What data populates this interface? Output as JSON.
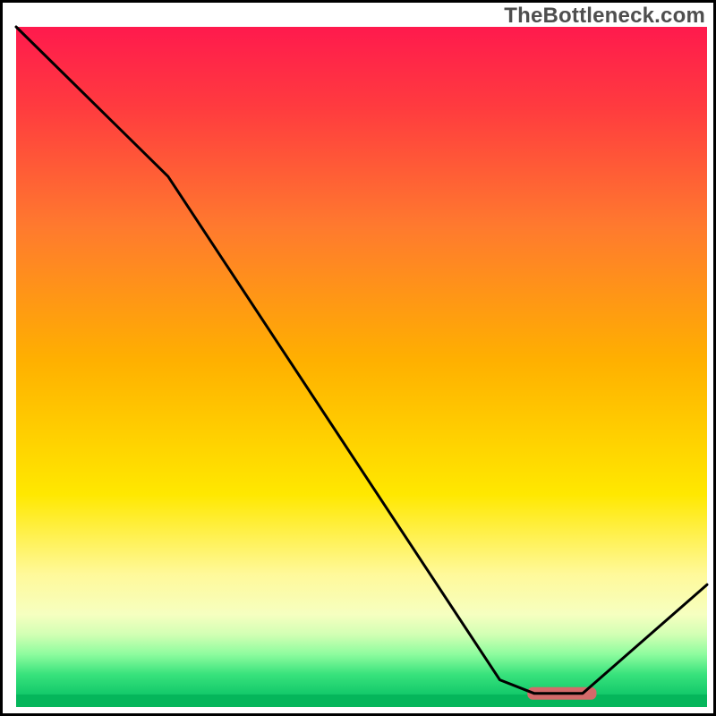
{
  "watermark": "TheBottleneck.com",
  "chart_data": {
    "type": "line",
    "title": "",
    "xlabel": "",
    "ylabel": "",
    "xlim": [
      0,
      100
    ],
    "ylim": [
      0,
      100
    ],
    "axes_visible": false,
    "grid": false,
    "series": [
      {
        "name": "curve",
        "x": [
          0,
          22,
          70,
          75,
          82,
          100
        ],
        "values": [
          100,
          78,
          4,
          2,
          2,
          18
        ]
      }
    ],
    "marker": {
      "name": "highlight-segment",
      "x_start": 74,
      "x_end": 84,
      "y": 2,
      "color": "#d46a6a"
    },
    "background": {
      "type": "vertical-gradient",
      "stops": [
        {
          "offset": 0.0,
          "color": "#ff1a4d"
        },
        {
          "offset": 0.12,
          "color": "#ff3b3f"
        },
        {
          "offset": 0.3,
          "color": "#ff7a2e"
        },
        {
          "offset": 0.5,
          "color": "#ffb000"
        },
        {
          "offset": 0.7,
          "color": "#ffe800"
        },
        {
          "offset": 0.82,
          "color": "#fff99a"
        },
        {
          "offset": 0.88,
          "color": "#f6ffc0"
        },
        {
          "offset": 0.91,
          "color": "#d2ffb4"
        },
        {
          "offset": 0.94,
          "color": "#8dfc9e"
        },
        {
          "offset": 0.97,
          "color": "#38e27c"
        },
        {
          "offset": 1.0,
          "color": "#13c96a"
        }
      ],
      "bottom_band_color": "#05b65b"
    },
    "border_color": "#000000"
  }
}
